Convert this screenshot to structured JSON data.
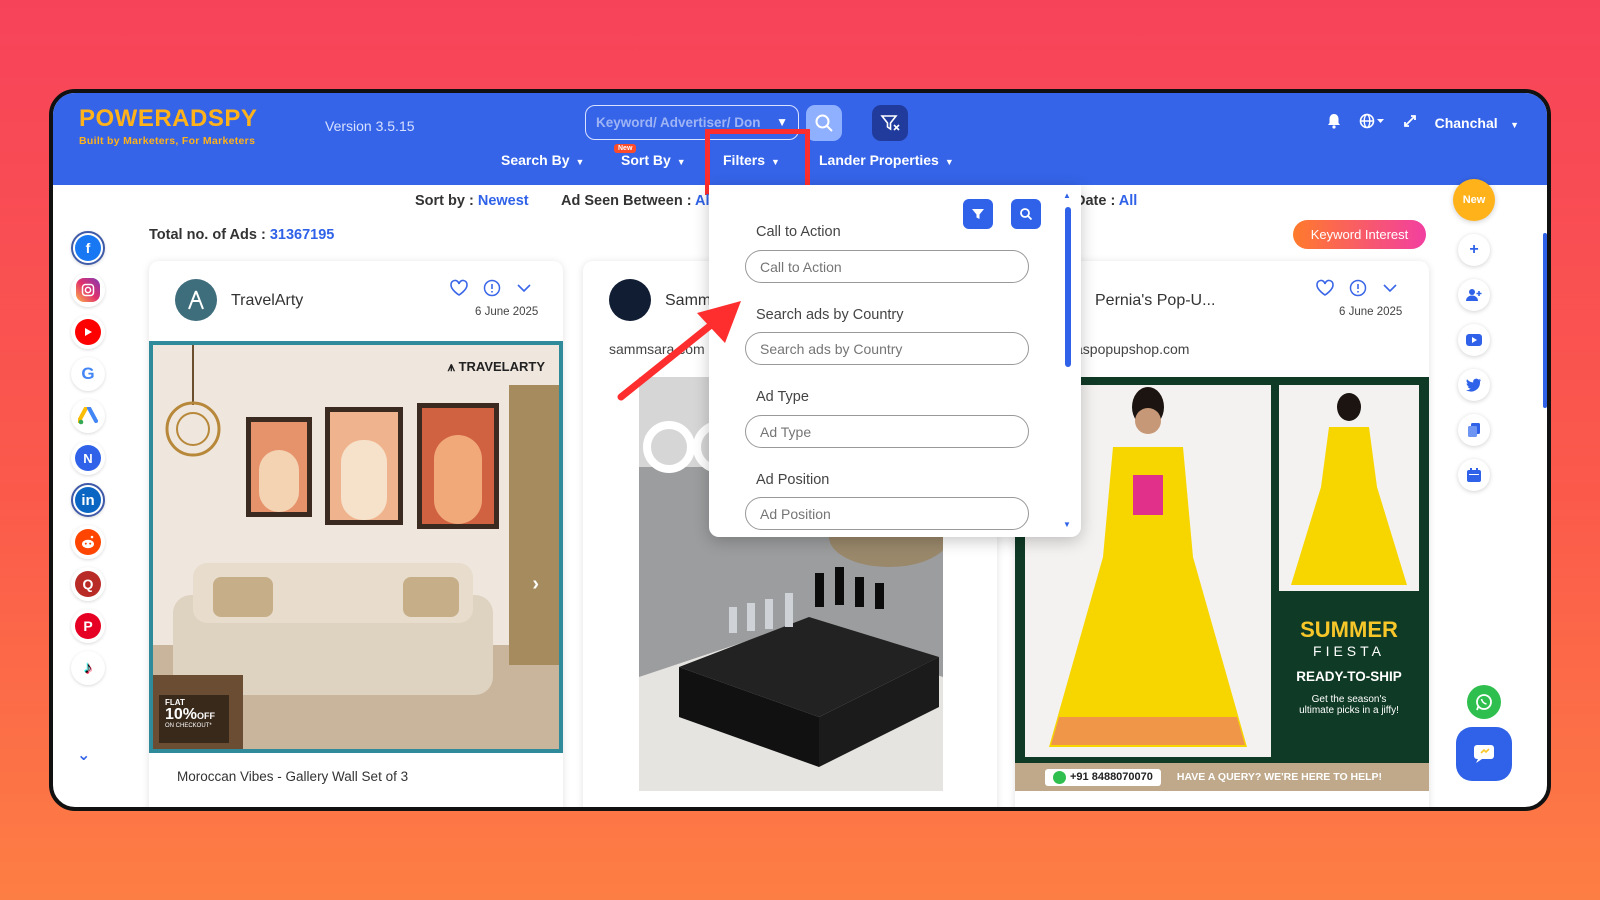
{
  "header": {
    "logo_main": "POWERADSPY",
    "logo_tagline": "Built by Marketers, For Marketers",
    "version": "Version 3.5.15",
    "search_placeholder": "Keyword/ Advertiser/ Don",
    "nav": {
      "search_by": "Search By",
      "sort_by": "Sort By",
      "new_badge": "New",
      "filters": "Filters",
      "lander_properties": "Lander Properties"
    },
    "user_name": "Chanchal",
    "colors": {
      "bar": "#3564e8",
      "logo": "#ffb21a",
      "highlight": "#ff2e2e"
    }
  },
  "sort_bar": {
    "sort_label": "Sort by :",
    "sort_value": "Newest",
    "ad_seen_label": "Ad Seen Between :",
    "ad_seen_value": "Al",
    "date_label": "Date :",
    "date_value": "All"
  },
  "total": {
    "label": "Total no. of Ads :",
    "value": "31367195"
  },
  "keyword_interest": "Keyword Interest",
  "social_icons": [
    "facebook-icon",
    "instagram-icon",
    "youtube-icon",
    "google-icon",
    "google-ads-icon",
    "native-icon",
    "linkedin-icon",
    "reddit-icon",
    "quora-icon",
    "pinterest-icon",
    "tiktok-icon"
  ],
  "filter_panel": {
    "fields": [
      {
        "label": "Call to Action",
        "placeholder": "Call to Action"
      },
      {
        "label": "Search ads by Country",
        "placeholder": "Search ads by Country"
      },
      {
        "label": "Ad Type",
        "placeholder": "Ad Type"
      },
      {
        "label": "Ad Position",
        "placeholder": "Ad Position"
      }
    ]
  },
  "cards": [
    {
      "advertiser": "TravelArty",
      "date": "6 June 2025",
      "brand_mark": "TRAVELARTY",
      "promo_flat": "FLAT",
      "promo_pct": "10%",
      "promo_off": "OFF",
      "promo_sub": "ON CHECKOUT*",
      "caption": "Moroccan Vibes - Gallery Wall Set of 3"
    },
    {
      "advertiser": "Samm",
      "domain": "sammsara.com"
    },
    {
      "advertiser": "Pernia's Pop-U...",
      "date": "6 June 2025",
      "domain": "aspopupshop.com",
      "headline": "SUMMER",
      "headline_sub": "FIESTA",
      "tagline": "READY-TO-SHIP",
      "body1": "Get the season's",
      "body2": "ultimate picks in a jiffy!",
      "phone": "+91 8488070070",
      "query": "HAVE A QUERY? WE'RE HERE TO HELP!"
    }
  ],
  "rail": {
    "new": "New"
  }
}
